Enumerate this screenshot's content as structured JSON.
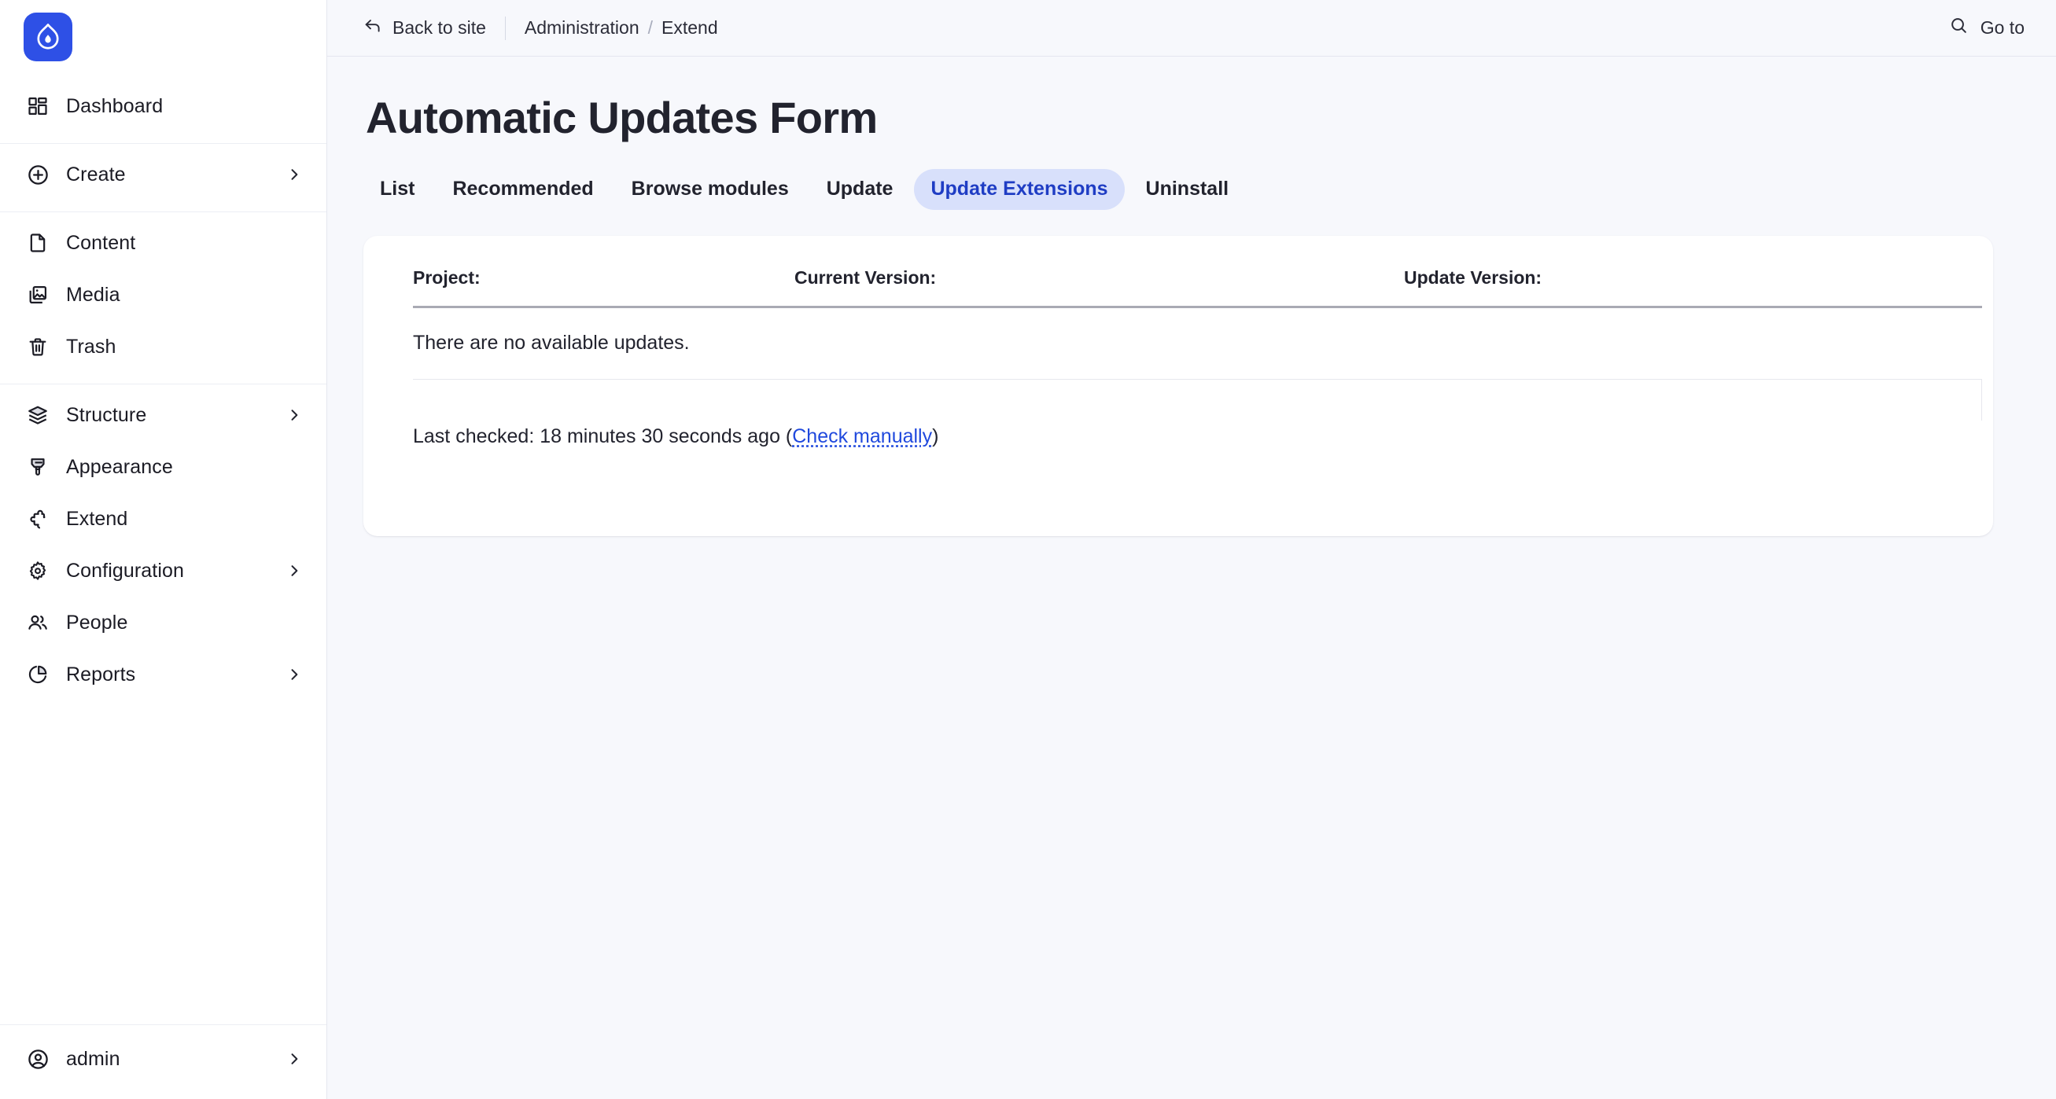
{
  "brand": {
    "logo_icon": "drupal-droplet-icon",
    "logo_color": "#2e50e6"
  },
  "sidebar": {
    "primary": [
      {
        "label": "Dashboard",
        "icon": "dashboard-grid-icon",
        "expandable": false
      }
    ],
    "create": [
      {
        "label": "Create",
        "icon": "plus-circle-icon",
        "expandable": true
      }
    ],
    "content_group": [
      {
        "label": "Content",
        "icon": "document-icon",
        "expandable": false
      },
      {
        "label": "Media",
        "icon": "image-icon",
        "expandable": false
      },
      {
        "label": "Trash",
        "icon": "trash-icon",
        "expandable": false
      }
    ],
    "admin_group": [
      {
        "label": "Structure",
        "icon": "layers-icon",
        "expandable": true
      },
      {
        "label": "Appearance",
        "icon": "paint-brush-icon",
        "expandable": false
      },
      {
        "label": "Extend",
        "icon": "puzzle-piece-icon",
        "expandable": false
      },
      {
        "label": "Configuration",
        "icon": "gear-icon",
        "expandable": true
      },
      {
        "label": "People",
        "icon": "people-icon",
        "expandable": false
      },
      {
        "label": "Reports",
        "icon": "pie-chart-icon",
        "expandable": true
      }
    ],
    "footer": {
      "label": "admin",
      "icon": "user-circle-icon",
      "expandable": true
    }
  },
  "topbar": {
    "back_to_site": "Back to site",
    "back_icon": "back-arrow-icon",
    "breadcrumb": {
      "root": "Administration",
      "separator": "/",
      "current": "Extend"
    },
    "go_to": "Go to",
    "search_icon": "search-icon"
  },
  "page": {
    "title": "Automatic Updates Form"
  },
  "tabs": [
    {
      "label": "List",
      "active": false
    },
    {
      "label": "Recommended",
      "active": false
    },
    {
      "label": "Browse modules",
      "active": false
    },
    {
      "label": "Update",
      "active": false
    },
    {
      "label": "Update Extensions",
      "active": true
    },
    {
      "label": "Uninstall",
      "active": false
    }
  ],
  "updates_table": {
    "headers": {
      "project": "Project:",
      "current_version": "Current Version:",
      "update_version": "Update Version:"
    },
    "empty_message": "There are no available updates.",
    "rows": []
  },
  "status": {
    "prefix": "Last checked: 18 minutes 30 seconds ago (",
    "link": "Check manually",
    "suffix": ")"
  },
  "colors": {
    "accent": "#2e50e6",
    "active_tab_bg": "#d8e0fb",
    "active_tab_text": "#1f3dc4",
    "link": "#2049dd",
    "page_bg": "#f7f8fc"
  }
}
